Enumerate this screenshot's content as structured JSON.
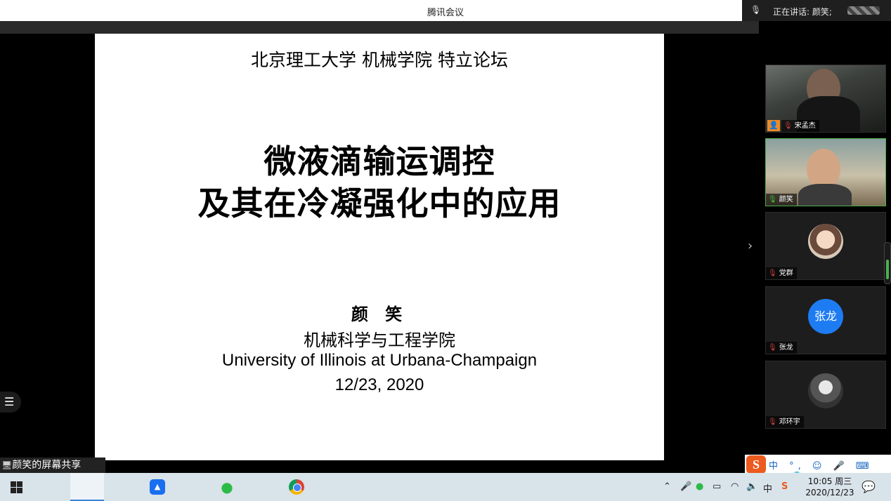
{
  "window": {
    "title": "腾讯会议"
  },
  "speaking": {
    "text": "正在讲话: 颜笑;"
  },
  "slide": {
    "header": "北京理工大学 机械学院 特立论坛",
    "title_line1": "微液滴输运调控",
    "title_line2": "及其在冷凝强化中的应用",
    "author": "颜 笑",
    "dept": "机械科学与工程学院",
    "university": "University of Illinois at Urbana-Champaign",
    "date": "12/23, 2020"
  },
  "participants": [
    {
      "name": "宋孟杰",
      "mic": "muted",
      "video": true
    },
    {
      "name": "颜笑",
      "mic": "active",
      "video": true
    },
    {
      "name": "党群",
      "mic": "muted",
      "video": false
    },
    {
      "name": "张龙",
      "mic": "muted",
      "video": false,
      "avatar_text": "张龙"
    },
    {
      "name": "邓环宇",
      "mic": "muted",
      "video": false
    }
  ],
  "share_bar": {
    "label": "颜笑的屏幕共享"
  },
  "ime": {
    "items": "中 °, ☺ 🎤 ⌨ 👥 👕 ⊞"
  },
  "taskbar": {
    "time": "10:05 周三",
    "date": "2020/12/23",
    "tray_lang": "中"
  },
  "colors": {
    "accent_green": "#4caf50",
    "avatar_blue": "#1e7cf2"
  }
}
